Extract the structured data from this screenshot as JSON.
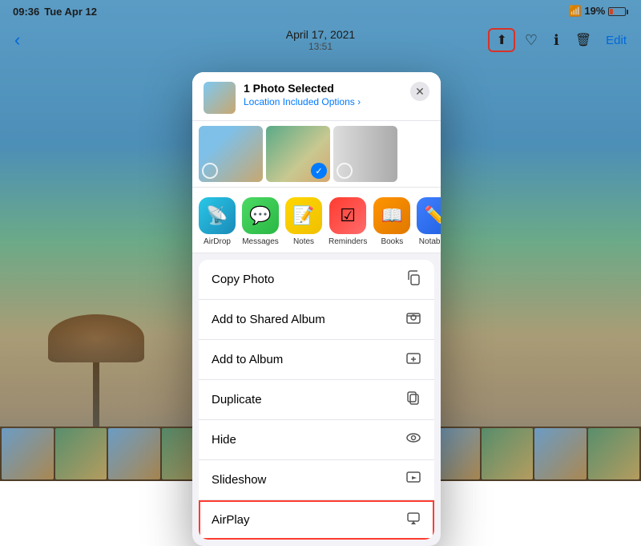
{
  "status_bar": {
    "time": "09:36",
    "day": "Tue Apr 12",
    "date_center": "April 17, 2021",
    "time_center": "13:51",
    "battery": "19%"
  },
  "nav": {
    "back_label": "‹",
    "share_label": "⬆",
    "heart_label": "♡",
    "info_label": "ⓘ",
    "trash_label": "🗑",
    "edit_label": "Edit"
  },
  "sheet": {
    "title": "1 Photo Selected",
    "subtitle": "Location Included",
    "options_label": "Options ›",
    "close_label": "✕"
  },
  "app_icons": [
    {
      "id": "airdrop",
      "label": "AirDrop",
      "icon": "📡"
    },
    {
      "id": "messages",
      "label": "Messages",
      "icon": "💬"
    },
    {
      "id": "notes",
      "label": "Notes",
      "icon": "📝"
    },
    {
      "id": "reminders",
      "label": "Reminders",
      "icon": "☑"
    },
    {
      "id": "books",
      "label": "Books",
      "icon": "📖"
    },
    {
      "id": "notability",
      "label": "Notability",
      "icon": "✏️"
    }
  ],
  "actions": [
    {
      "id": "copy-photo",
      "label": "Copy Photo",
      "icon": "⧉"
    },
    {
      "id": "add-to-shared-album",
      "label": "Add to Shared Album",
      "icon": "🖼"
    },
    {
      "id": "add-to-album",
      "label": "Add to Album",
      "icon": "🗂"
    },
    {
      "id": "duplicate",
      "label": "Duplicate",
      "icon": "⧉"
    },
    {
      "id": "hide",
      "label": "Hide",
      "icon": "👁"
    },
    {
      "id": "slideshow",
      "label": "Slideshow",
      "icon": "▶"
    },
    {
      "id": "airplay",
      "label": "AirPlay",
      "icon": "⬛"
    }
  ],
  "colors": {
    "accent": "#007AFF",
    "destructive": "#ff3b30",
    "highlighted_border": "#ff3b30"
  }
}
